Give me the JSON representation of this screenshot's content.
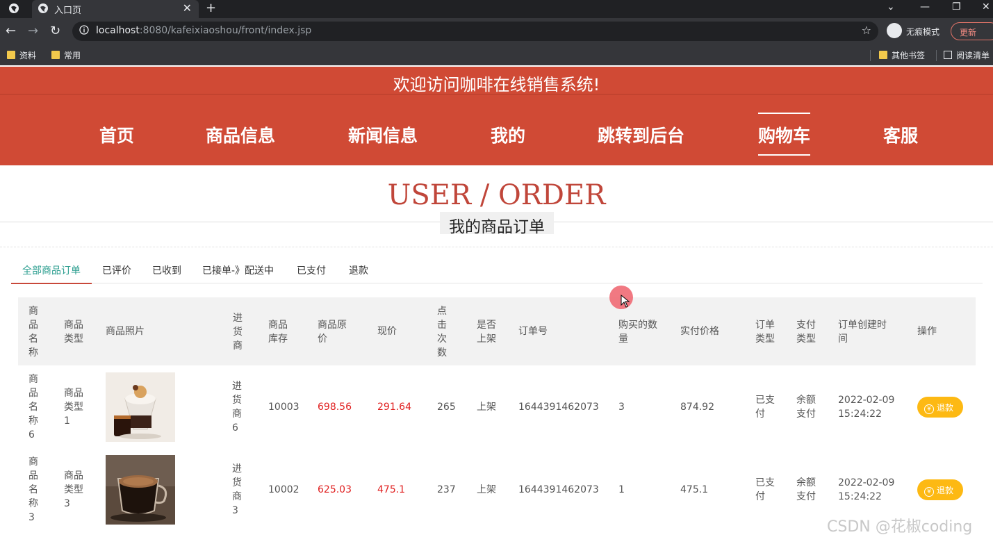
{
  "browser": {
    "tab_title": "入口页",
    "url_host": "localhost",
    "url_rest": ":8080/kafeixiaoshou/front/index.jsp",
    "incognito_label": "无痕模式",
    "update_label": "更新",
    "bookmarks": [
      "资料",
      "常用",
      "其他书签",
      "阅读清单"
    ]
  },
  "site": {
    "welcome": "欢迎访问咖啡在线销售系统!",
    "nav": [
      "首页",
      "商品信息",
      "新闻信息",
      "我的",
      "跳转到后台",
      "购物车",
      "客服"
    ],
    "active_nav": "购物车"
  },
  "section": {
    "title": "USER / ORDER",
    "subtitle": "我的商品订单"
  },
  "tabs": [
    "全部商品订单",
    "已评价",
    "已收到",
    "已接单-》配送中",
    "已支付",
    "退款"
  ],
  "table": {
    "headers": [
      "商品名称",
      "商品类型",
      "商品照片",
      "进货商",
      "商品库存",
      "商品原价",
      "现价",
      "点击次数",
      "是否上架",
      "订单号",
      "购买的数量",
      "实付价格",
      "订单类型",
      "支付类型",
      "订单创建时间",
      "操作"
    ],
    "rows": [
      {
        "name": "商品名称6",
        "type": "商品类型1",
        "supplier": "进货商6",
        "stock": "10003",
        "orig_price": "698.56",
        "price": "291.64",
        "clicks": "265",
        "listed": "上架",
        "order_no": "1644391462073",
        "qty": "3",
        "paid": "874.92",
        "order_type": "已支付",
        "pay_type": "余额支付",
        "created_date": "2022-02-09",
        "created_time": "15:24:22",
        "action": "退款"
      },
      {
        "name": "商品名称3",
        "type": "商品类型3",
        "supplier": "进货商3",
        "stock": "10002",
        "orig_price": "625.03",
        "price": "475.1",
        "clicks": "237",
        "listed": "上架",
        "order_no": "1644391462073",
        "qty": "1",
        "paid": "475.1",
        "order_type": "已支付",
        "pay_type": "余额支付",
        "created_date": "2022-02-09",
        "created_time": "15:24:22",
        "action": "退款"
      }
    ]
  },
  "watermark": "CSDN @花椒coding"
}
